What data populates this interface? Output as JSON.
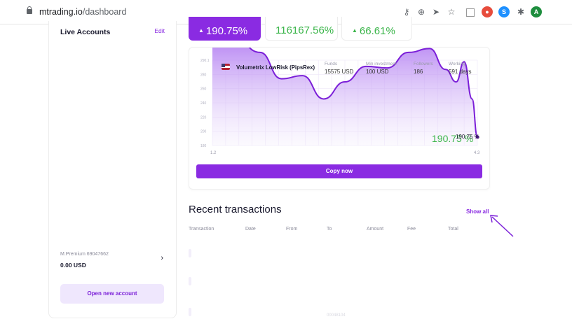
{
  "browser": {
    "domain": "mtrading.io",
    "path": "/dashboard",
    "avatar_letter": "A"
  },
  "sidebar": {
    "title": "Live Accounts",
    "edit_label": "Edit",
    "account": {
      "name": "M.Premium 69047662",
      "balance": "0.00 USD"
    },
    "open_account_label": "Open new account"
  },
  "stats": [
    {
      "value": "190.75%",
      "arrow": "▲"
    },
    {
      "value": "116167.56%"
    },
    {
      "value": "66.61%",
      "arrow": "▲"
    }
  ],
  "fund": {
    "name": "Volumetrix LowRisk (PipsRex)",
    "info": [
      {
        "label": "Funds",
        "value": "15575 USD"
      },
      {
        "label": "Min investment",
        "value": "100 USD"
      },
      {
        "label": "Followers",
        "value": "186"
      },
      {
        "label": "Working",
        "value": "591 days"
      }
    ],
    "current_label": "190.75 %",
    "copy_label": "Copy now"
  },
  "chart_data": {
    "type": "area",
    "x_tick_labels": [
      "1.2",
      "4.3"
    ],
    "y_tick_labels": [
      "180",
      "200",
      "220",
      "240",
      "260",
      "280",
      "290.1"
    ],
    "x": [
      0,
      0.08,
      0.18,
      0.26,
      0.34,
      0.42,
      0.5,
      0.58,
      0.66,
      0.74,
      0.82,
      0.88,
      0.92,
      0.95,
      0.98,
      1.0
    ],
    "values": [
      310,
      330,
      300,
      266,
      270,
      240,
      262,
      282,
      280,
      300,
      305,
      278,
      262,
      288,
      240,
      191
    ],
    "ylim": [
      180,
      290
    ],
    "color": "#8a2be2"
  },
  "transactions": {
    "title": "Recent transactions",
    "show_all_label": "Show all",
    "columns": [
      "Transaction",
      "Date",
      "From",
      "To",
      "Amount",
      "Fee",
      "Total"
    ],
    "faint_text": "00048104"
  }
}
